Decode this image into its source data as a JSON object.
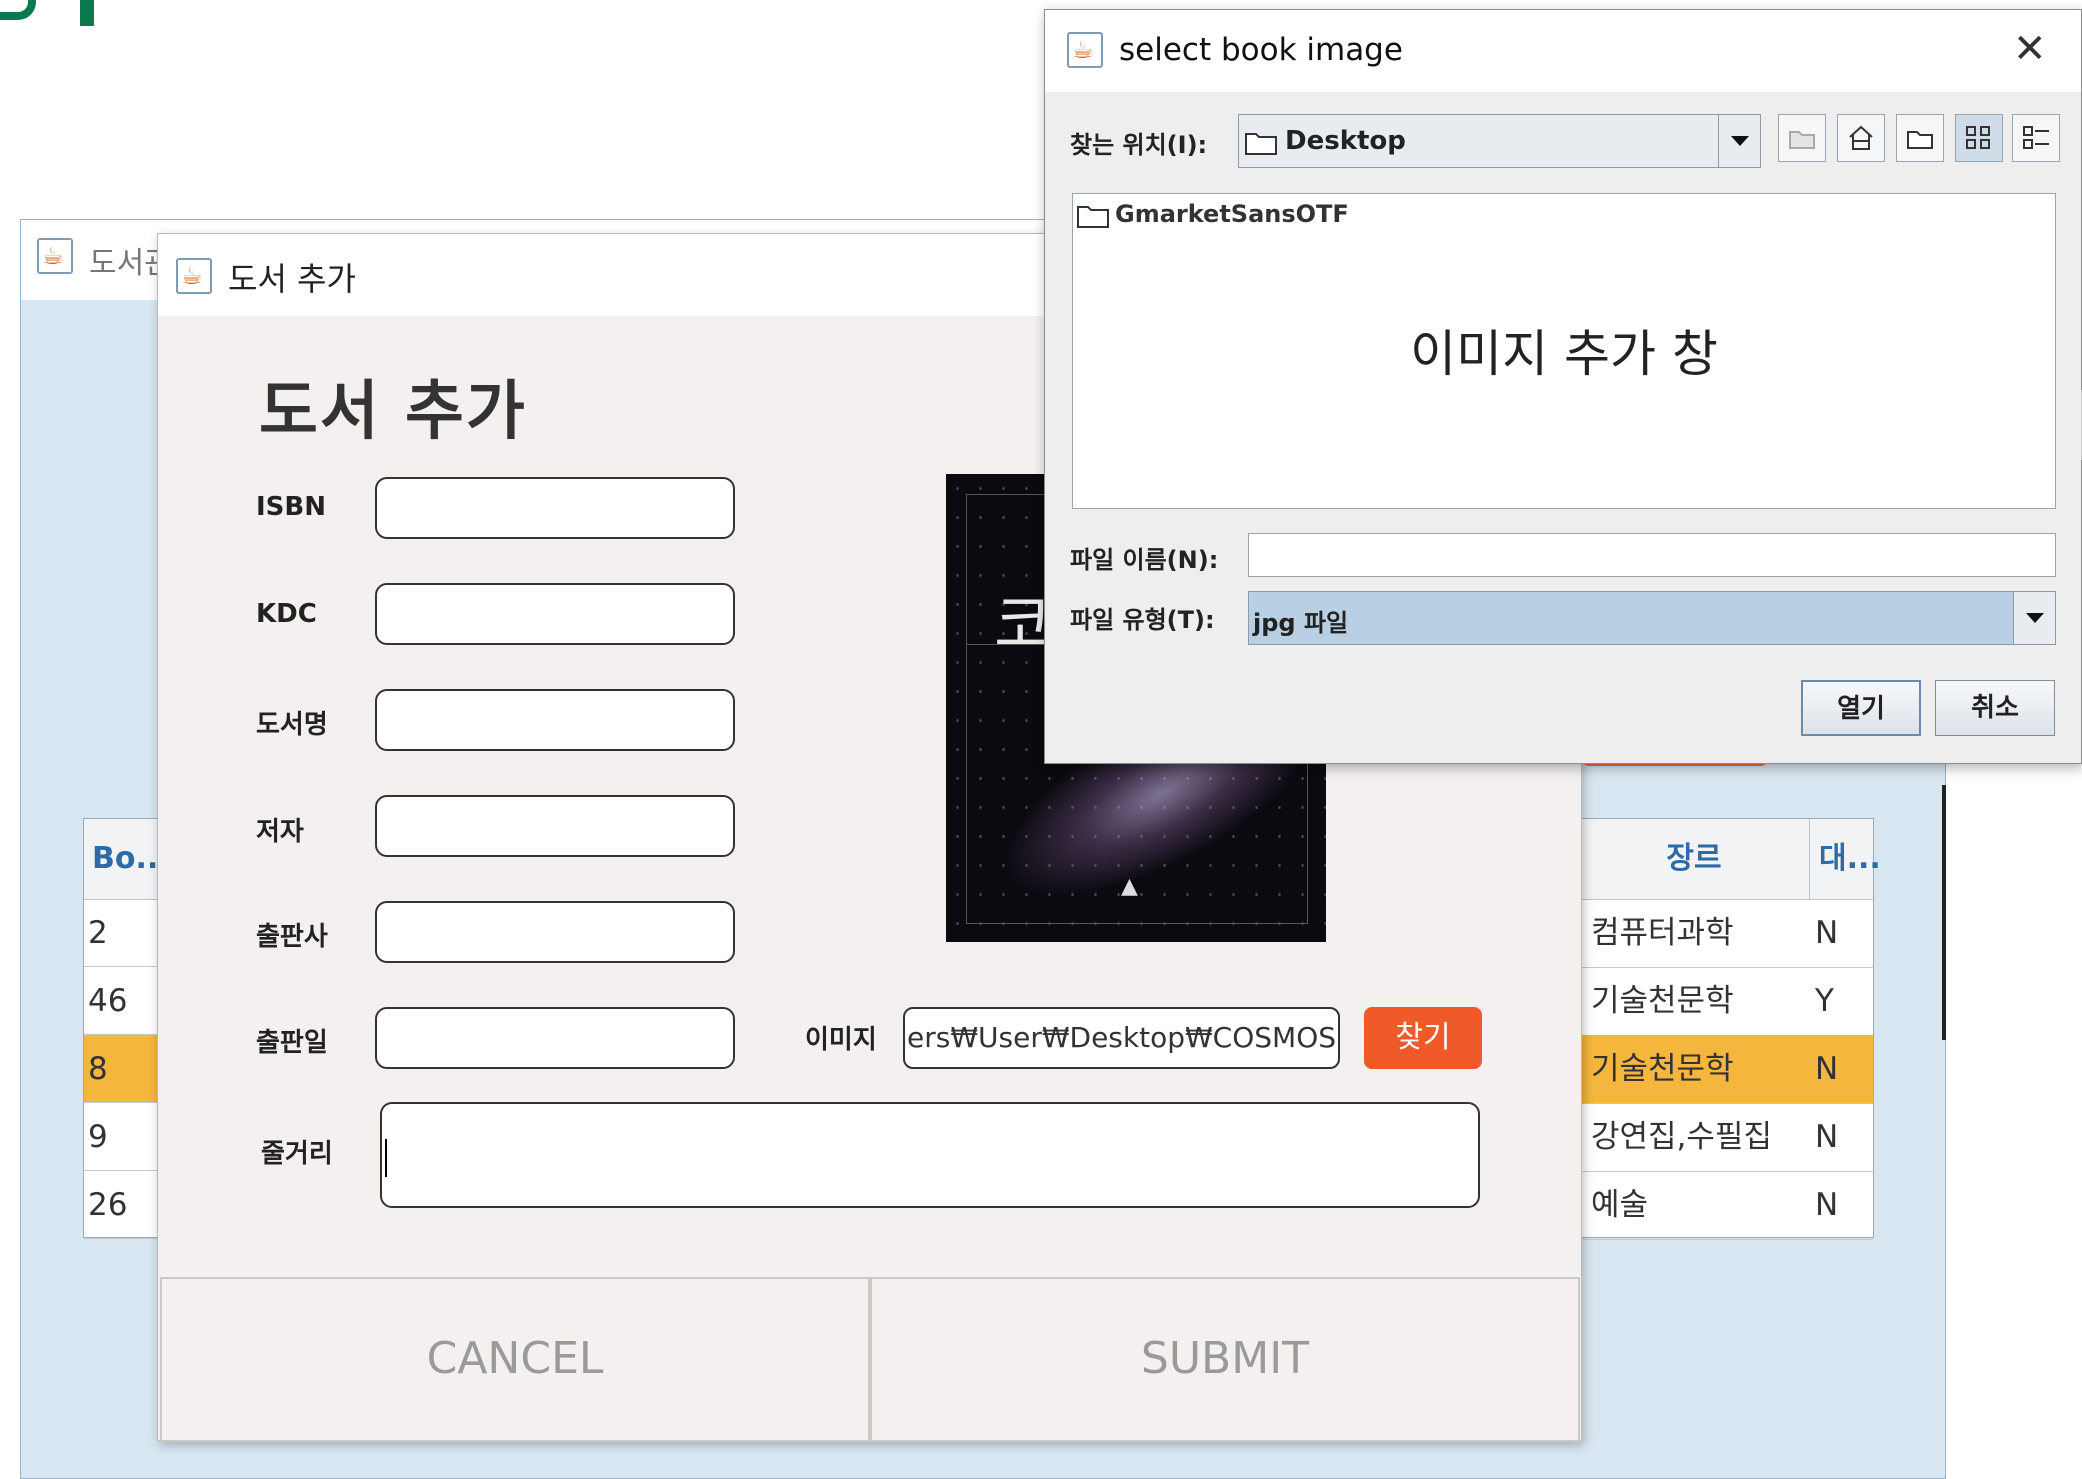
{
  "background_window": {
    "title": "도서관",
    "table_left": {
      "header": "Bo...",
      "rows": [
        "2",
        "46",
        "8",
        "9",
        "26"
      ]
    },
    "table_right": {
      "headers": [
        "장르",
        "대..."
      ],
      "rows": [
        {
          "genre": "컴퓨터과학",
          "flag": "N"
        },
        {
          "genre": "기술천문학",
          "flag": "Y"
        },
        {
          "genre": "기술천문학",
          "flag": "N"
        },
        {
          "genre": "강연집,수필집",
          "flag": "N"
        },
        {
          "genre": "예술",
          "flag": "N"
        }
      ],
      "selected_row_index": 2
    }
  },
  "add_book_dialog": {
    "window_title": "도서 추가",
    "heading": "도서 추가",
    "labels": {
      "isbn": "ISBN",
      "kdc": "KDC",
      "title": "도서명",
      "author": "저자",
      "publisher": "출판사",
      "pub_date": "출판일",
      "image": "이미지",
      "plot": "줄거리"
    },
    "values": {
      "isbn": "",
      "kdc": "",
      "title": "",
      "author": "",
      "publisher": "",
      "pub_date": "",
      "image_path": "ers₩User₩Desktop₩COSMOS.jpg",
      "plot": ""
    },
    "find_button": "찾기",
    "cover_glyph": "코",
    "cancel_button": "CANCEL",
    "submit_button": "SUBMIT"
  },
  "file_chooser": {
    "window_title": "select book image",
    "look_in_label": "찾는 위치(I):",
    "look_in_value": "Desktop",
    "files": [
      "GmarketSansOTF"
    ],
    "caption": "이미지 추가 창",
    "file_name_label": "파일 이름(N):",
    "file_name_value": "",
    "file_type_label": "파일 유형(T):",
    "file_type_value": "jpg 파일",
    "open_button": "열기",
    "cancel_button": "취소"
  },
  "colors": {
    "accent_orange": "#f05a28",
    "selection": "#f4b63c",
    "header_text": "#2d6aa7",
    "bg_window": "#d8e6f1",
    "deco_green": "#0a7a4e"
  }
}
